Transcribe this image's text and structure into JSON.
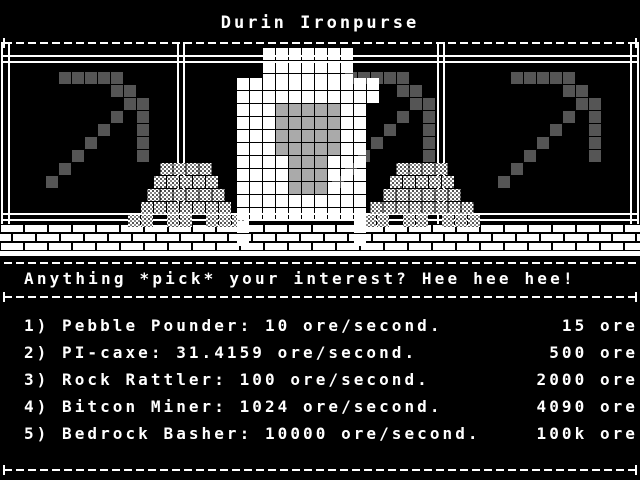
{
  "header": {
    "title": "Durin Ironpurse"
  },
  "dialog": {
    "greeting": "Anything *pick* your interest? Hee hee hee!"
  },
  "shop": {
    "items": [
      {
        "label": "1) Pebble Pounder: 10 ore/second.",
        "price": "15 ore"
      },
      {
        "label": "2) PI-caxe: 31.4159 ore/second.",
        "price": "500 ore"
      },
      {
        "label": "3) Rock Rattler: 100 ore/second.",
        "price": "2000 ore"
      },
      {
        "label": "4) Bitcon Miner: 1024 ore/second.",
        "price": "4090 ore"
      },
      {
        "label": "5) Bedrock Basher: 10000 ore/second.",
        "price": "100k ore"
      }
    ]
  },
  "colors": {
    "background": "#000000",
    "text": "#ffffff",
    "pickaxe": "#555555",
    "ore": "#aaaaaa"
  },
  "icons": {
    "left": "pickaxe-icon",
    "right": "pickaxe-icon",
    "center": "dwarf-merchant-sprite",
    "piles": "ore-pile-icon"
  }
}
